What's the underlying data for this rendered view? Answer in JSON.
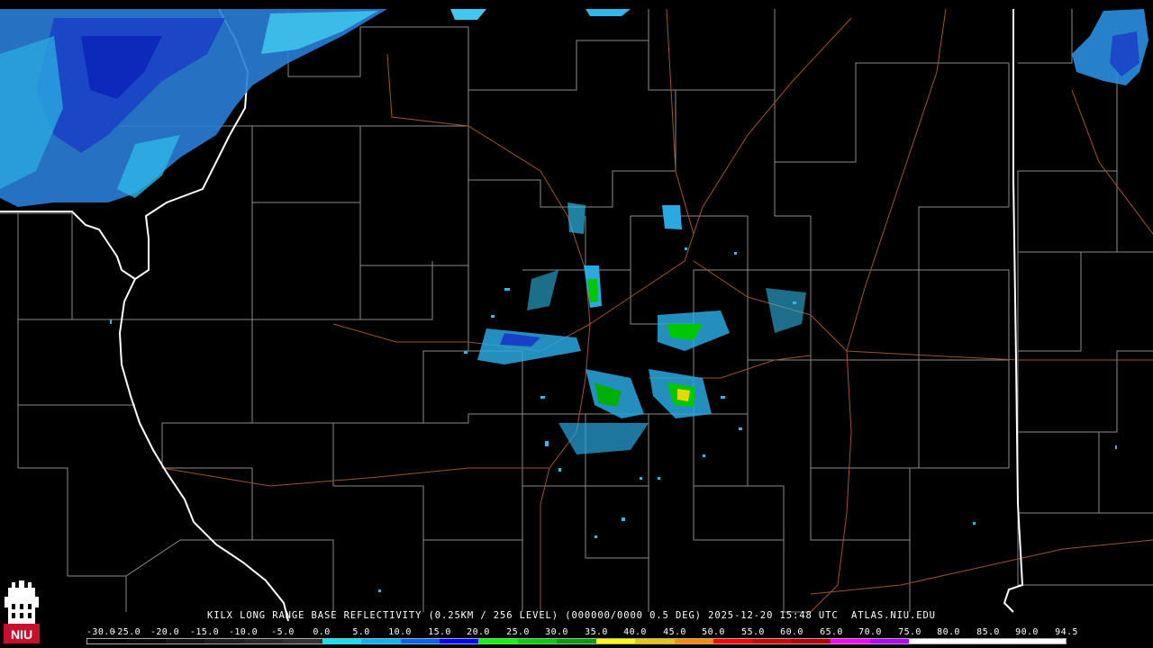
{
  "caption": {
    "station": "KILX",
    "product": "LONG RANGE BASE REFLECTIVITY",
    "resolution": "(0.25KM / 256 LEVEL)",
    "volume": "(000000/0000 0.5 DEG)",
    "timestamp": "2025-12-20 15:48 UTC",
    "source": "ATLAS.NIU.EDU"
  },
  "logo": {
    "text": "NIU",
    "icon": "niu-logo-icon",
    "color": "#c8102e"
  },
  "colors": {
    "background": "#000000",
    "county_lines": "#8a8a8a",
    "state_lines": "#ffffff",
    "highways": "#a0522d"
  },
  "scale": {
    "labels": [
      "-30.0",
      "-25.0",
      "-20.0",
      "-15.0",
      "-10.0",
      "-5.0",
      "0.0",
      "5.0",
      "10.0",
      "15.0",
      "20.0",
      "25.0",
      "30.0",
      "35.0",
      "40.0",
      "45.0",
      "50.0",
      "55.0",
      "60.0",
      "65.0",
      "70.0",
      "75.0",
      "80.0",
      "85.0",
      "90.0",
      "94.5"
    ],
    "colors": [
      "#000000",
      "#0a0a0a",
      "#141414",
      "#1e1e1e",
      "#282828",
      "#323232",
      "#00e6ff",
      "#00b4ff",
      "#0064ff",
      "#0000ff",
      "#00ff00",
      "#00d000",
      "#00a000",
      "#ffff00",
      "#e6c800",
      "#ff8c00",
      "#ff0000",
      "#d20000",
      "#b40000",
      "#ff00ff",
      "#b400ff",
      "#ffffff",
      "#ffffff",
      "#ffffff",
      "#ffffff"
    ]
  }
}
